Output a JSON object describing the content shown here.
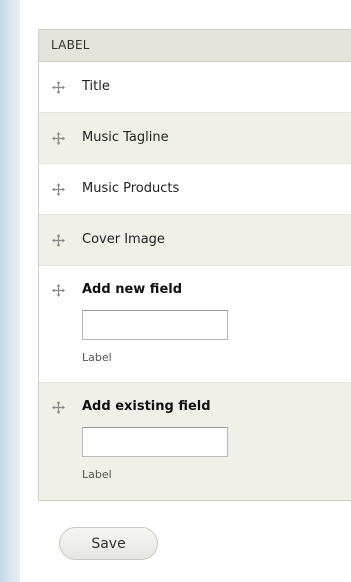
{
  "table": {
    "header_label": "LABEL",
    "rows": [
      {
        "label": "Title"
      },
      {
        "label": "Music Tagline"
      },
      {
        "label": "Music Products"
      },
      {
        "label": "Cover Image"
      }
    ],
    "add_new": {
      "label": "Add new field",
      "input_value": "",
      "description": "Label"
    },
    "add_existing": {
      "label": "Add existing field",
      "input_value": "",
      "description": "Label"
    }
  },
  "actions": {
    "save_label": "Save"
  },
  "icons": {
    "drag_handle": "drag-handle-icon",
    "drag_color": "#8a8a8a"
  }
}
